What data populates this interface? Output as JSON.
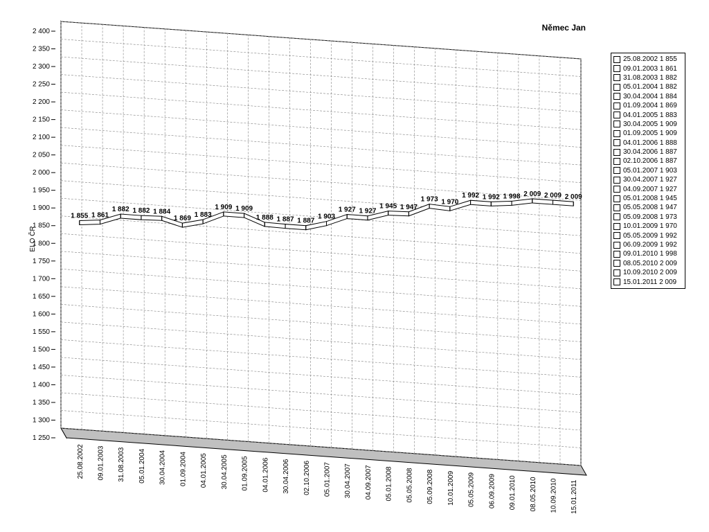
{
  "chart_data": {
    "type": "line",
    "title": "Němec Jan",
    "ylabel": "ELO ČR",
    "xlabel": "",
    "ylim": [
      1250,
      2400
    ],
    "ytick_step": 50,
    "grid": true,
    "legend_position": "right",
    "categories": [
      "25.08.2002",
      "09.01.2003",
      "31.08.2003",
      "05.01.2004",
      "30.04.2004",
      "01.09.2004",
      "04.01.2005",
      "30.04.2005",
      "01.09.2005",
      "04.01.2006",
      "30.04.2006",
      "02.10.2006",
      "05.01.2007",
      "30.04.2007",
      "04.09.2007",
      "05.01.2008",
      "05.05.2008",
      "05.09.2008",
      "10.01.2009",
      "05.05.2009",
      "06.09.2009",
      "09.01.2010",
      "08.05.2010",
      "10.09.2010",
      "15.01.2011"
    ],
    "values": [
      1855,
      1861,
      1882,
      1882,
      1884,
      1869,
      1883,
      1909,
      1909,
      1888,
      1887,
      1887,
      1903,
      1927,
      1927,
      1945,
      1947,
      1973,
      1970,
      1992,
      1992,
      1998,
      2009,
      2009,
      2009
    ],
    "data_labels": [
      "1 855",
      "1 861",
      "1 882",
      "1 882",
      "1 884",
      "1 869",
      "1 883",
      "1 909",
      "1 909",
      "1 888",
      "1 887",
      "1 887",
      "1 903",
      "1 927",
      "1 927",
      "1 945",
      "1 947",
      "1 973",
      "1 970",
      "1 992",
      "1 992",
      "1 998",
      "2 009",
      "2 009",
      "2 009"
    ],
    "y_tick_labels": [
      "1 250",
      "1 300",
      "1 350",
      "1 400",
      "1 450",
      "1 500",
      "1 550",
      "1 600",
      "1 650",
      "1 700",
      "1 750",
      "1 800",
      "1 850",
      "1 900",
      "1 950",
      "2 000",
      "2 050",
      "2 100",
      "2 150",
      "2 200",
      "2 250",
      "2 300",
      "2 350",
      "2 400"
    ],
    "legend_entries": [
      "25.08.2002 1 855",
      "09.01.2003 1 861",
      "31.08.2003 1 882",
      "05.01.2004 1 882",
      "30.04.2004 1 884",
      "01.09.2004 1 869",
      "04.01.2005 1 883",
      "30.04.2005 1 909",
      "01.09.2005 1 909",
      "04.01.2006 1 888",
      "30.04.2006 1 887",
      "02.10.2006 1 887",
      "05.01.2007 1 903",
      "30.04.2007 1 927",
      "04.09.2007 1 927",
      "05.01.2008 1 945",
      "05.05.2008 1 947",
      "05.09.2008 1 973",
      "10.01.2009 1 970",
      "05.05.2009 1 992",
      "06.09.2009 1 992",
      "09.01.2010 1 998",
      "08.05.2010 2 009",
      "10.09.2010 2 009",
      "15.01.2011 2 009"
    ],
    "colors": {
      "line": "#000000",
      "ribbon": "#ffffff",
      "grid": "#808080",
      "wall": "#c0c0c0"
    }
  }
}
